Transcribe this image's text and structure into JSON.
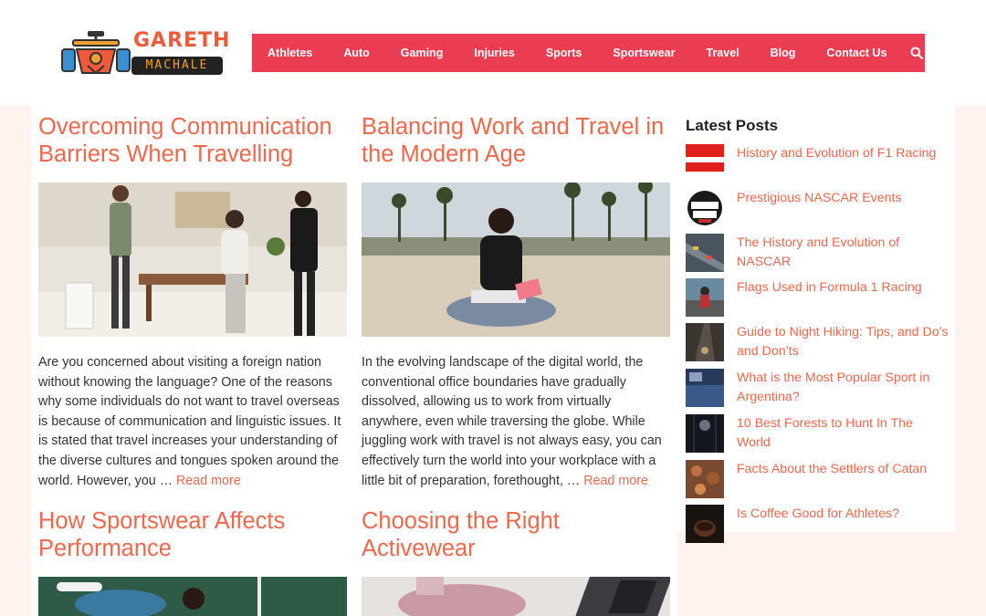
{
  "brand": {
    "name_top": "GARETH",
    "name_bottom": "MACHALE"
  },
  "nav": {
    "items": [
      "Athletes",
      "Auto",
      "Gaming",
      "Injuries",
      "Sports",
      "Sportswear",
      "Travel",
      "Blog",
      "Contact Us"
    ],
    "search_icon": "search-icon"
  },
  "posts": [
    {
      "title": "Overcoming Communication Barriers When Travelling",
      "excerpt": "Are you concerned about visiting a foreign nation without knowing the language? One of the reasons why some individuals do not want to travel overseas is because of communication and linguistic issues. It is stated that travel increases your understanding of the diverse cultures and tongues spoken around the world. However, you …",
      "read_more": "Read more"
    },
    {
      "title": "Balancing Work and Travel in the Modern Age",
      "excerpt": "In the evolving landscape of the digital world, the conventional office boundaries have gradually dissolved, allowing us to work from virtually anywhere, even while traversing the globe. While juggling work with travel is not always easy, you can effectively turn the world into your workplace with a little bit of preparation, forethought, …",
      "read_more": "Read more"
    },
    {
      "title": "How Sportswear Affects Performance"
    },
    {
      "title": "Choosing the Right Activewear"
    }
  ],
  "sidebar": {
    "title": "Latest Posts",
    "items": [
      "History and Evolution of F1 Racing",
      "Prestigious NASCAR Events",
      "The History and Evolution of NASCAR",
      "Flags Used in Formula 1 Racing",
      "Guide to Night Hiking: Tips, and Do’s and Don’ts",
      "What is the Most Popular Sport in Argentina?",
      "10 Best Forests to Hunt In The World",
      "Facts About the Settlers of Catan",
      "Is Coffee Good for Athletes?"
    ]
  },
  "colors": {
    "accent": "#f0674a",
    "nav_bg": "#ea3d52",
    "page_bg": "#fff3f0"
  }
}
